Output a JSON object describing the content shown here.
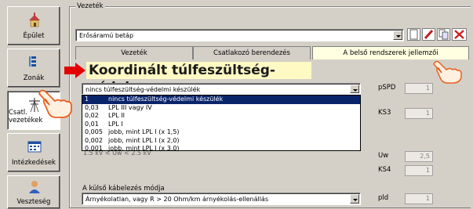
{
  "nav": {
    "items": [
      {
        "label": "Épület",
        "icon": "building-icon"
      },
      {
        "label": "Zonák",
        "icon": "zones-icon"
      },
      {
        "label": "Csatl. vezetékek",
        "icon": "power-line-icon"
      },
      {
        "label": "Intézkedések",
        "icon": "measures-icon"
      },
      {
        "label": "Veszteség",
        "icon": "loss-icon"
      }
    ]
  },
  "group": {
    "title": "Vezeték"
  },
  "line_select": {
    "value": "Erősáramú betáp"
  },
  "tabs": [
    "Vezeték",
    "Csatlakozó berendezés",
    "A belső rendszerek jellemzői"
  ],
  "callout": "Koordinált túlfeszültség-védelem",
  "spd_select": {
    "value": "nincs túlfeszültség-védelmi készülék"
  },
  "dropdown_options": [
    {
      "code": "1",
      "text": "nincs túlfeszültség-védelmi készülék"
    },
    {
      "code": "0,03",
      "text": "LPL III vagy IV"
    },
    {
      "code": "0,02",
      "text": "LPL II"
    },
    {
      "code": "0,01",
      "text": "LPL I"
    },
    {
      "code": "0,005",
      "text": "jobb, mint LPL I (x 1,5)"
    },
    {
      "code": "0,002",
      "text": "jobb, mint LPL I (x 2,0)"
    },
    {
      "code": "0,001",
      "text": "jobb, mint LPL I (x 3,0)"
    }
  ],
  "hidden_row_partial": "1,5 kV < Uw < 2,5 kV",
  "external_cabling": {
    "label": "A külső kábelezés módja",
    "value": "Árnyékolatlan, vagy R > 20 Ohm/km árnyékolás-ellenállás"
  },
  "right_fields": [
    {
      "label": "pSPD",
      "value": "1"
    },
    {
      "label": "KS3",
      "value": "1"
    },
    {
      "label": "Uw",
      "value": "2,5"
    },
    {
      "label": "KS4",
      "value": "1"
    },
    {
      "label": "pld",
      "value": "1"
    }
  ],
  "colors": {
    "selection": "#0a246a",
    "callout_bg": "#fff9c4",
    "arrow": "#e30000"
  }
}
